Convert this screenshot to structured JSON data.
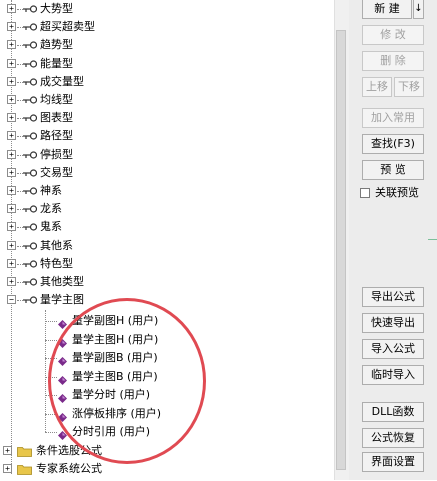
{
  "tree": {
    "items": [
      {
        "label": "大势型"
      },
      {
        "label": "超买超卖型"
      },
      {
        "label": "趋势型"
      },
      {
        "label": "能量型"
      },
      {
        "label": "成交量型"
      },
      {
        "label": "均线型"
      },
      {
        "label": "图表型"
      },
      {
        "label": "路径型"
      },
      {
        "label": "停损型"
      },
      {
        "label": "交易型"
      },
      {
        "label": "神系"
      },
      {
        "label": "龙系"
      },
      {
        "label": "鬼系"
      },
      {
        "label": "其他系"
      },
      {
        "label": "特色型"
      },
      {
        "label": "其他类型"
      },
      {
        "label": "量学主图"
      }
    ],
    "children": [
      {
        "label": "量学副图H  (用户)"
      },
      {
        "label": "量学主图H  (用户)"
      },
      {
        "label": "量学副图B  (用户)"
      },
      {
        "label": "量学主图B  (用户)"
      },
      {
        "label": "量学分时  (用户)"
      },
      {
        "label": "涨停板排序  (用户)"
      },
      {
        "label": "分时引用  (用户)"
      }
    ],
    "folders": [
      {
        "label": "条件选股公式"
      },
      {
        "label": "专家系统公式"
      }
    ]
  },
  "panel": {
    "new_label": "新 建",
    "edit_label": "修 改",
    "delete_label": "删 除",
    "up_label": "上移",
    "down_label": "下移",
    "add_common_label": "加入常用",
    "find_label": "查找(F3)",
    "preview_label": "预 览",
    "linked_preview_label": "关联预览",
    "export_label": "导出公式",
    "quick_export_label": "快速导出",
    "import_label": "导入公式",
    "temp_import_label": "临时导入",
    "dll_label": "DLL函数",
    "restore_label": "公式恢复",
    "ui_settings_label": "界面设置"
  },
  "colors": {
    "highlight_circle": "#e04a52",
    "diamond": "#7a2a8a",
    "folder": "#e8c64a"
  }
}
